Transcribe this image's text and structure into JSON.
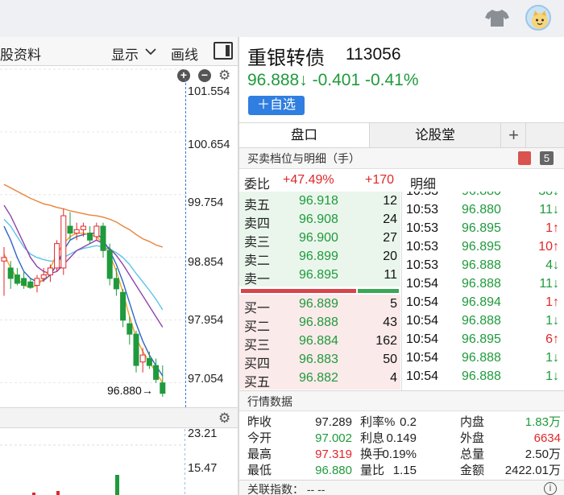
{
  "colors": {
    "up": "#e0262a",
    "down": "#1f9a3c",
    "accent": "#2f7ee0"
  },
  "topbar": {
    "icons": [
      "tshirt-icon",
      "avatar"
    ]
  },
  "left_toolbar": {
    "tab_partial": "股资料",
    "display": "显示",
    "display_icon": "chevron-down-icon",
    "draw": "画线",
    "layout_icon": "panel-toggle-icon"
  },
  "chart": {
    "price_labels": [
      "101.554",
      "100.654",
      "99.754",
      "98.854",
      "97.954",
      "97.054"
    ],
    "last_price": "96.880→",
    "sub_labels": [
      "23.21",
      "15.47"
    ],
    "zoom_icons": [
      "zoom-in-icon",
      "zoom-out-icon",
      "gear-icon"
    ]
  },
  "chart_data": {
    "type": "candlestick",
    "ylim": [
      96.7,
      101.6
    ],
    "candles": [
      {
        "o": 98.8,
        "h": 99.0,
        "l": 98.3,
        "c": 98.85
      },
      {
        "o": 98.7,
        "h": 98.8,
        "l": 98.4,
        "c": 98.55
      },
      {
        "o": 98.6,
        "h": 98.7,
        "l": 98.45,
        "c": 98.48
      },
      {
        "o": 98.55,
        "h": 98.65,
        "l": 98.4,
        "c": 98.45
      },
      {
        "o": 98.5,
        "h": 98.55,
        "l": 98.4,
        "c": 98.42
      },
      {
        "o": 98.45,
        "h": 98.6,
        "l": 98.35,
        "c": 98.55
      },
      {
        "o": 98.55,
        "h": 98.7,
        "l": 98.5,
        "c": 98.6
      },
      {
        "o": 98.6,
        "h": 98.75,
        "l": 98.5,
        "c": 98.7
      },
      {
        "o": 98.7,
        "h": 99.1,
        "l": 98.65,
        "c": 99.05
      },
      {
        "o": 98.7,
        "h": 99.55,
        "l": 98.6,
        "c": 99.45
      },
      {
        "o": 99.3,
        "h": 99.5,
        "l": 99.1,
        "c": 99.2
      },
      {
        "o": 99.2,
        "h": 99.35,
        "l": 99.1,
        "c": 99.25
      },
      {
        "o": 99.25,
        "h": 99.35,
        "l": 99.15,
        "c": 99.3
      },
      {
        "o": 99.2,
        "h": 99.3,
        "l": 99.05,
        "c": 99.1
      },
      {
        "o": 99.15,
        "h": 99.35,
        "l": 99.1,
        "c": 99.3
      },
      {
        "o": 99.3,
        "h": 99.35,
        "l": 98.85,
        "c": 98.95
      },
      {
        "o": 98.95,
        "h": 99.05,
        "l": 98.45,
        "c": 98.55
      },
      {
        "o": 98.55,
        "h": 98.7,
        "l": 98.3,
        "c": 98.4
      },
      {
        "o": 98.35,
        "h": 98.4,
        "l": 97.85,
        "c": 97.95
      },
      {
        "o": 97.9,
        "h": 98.0,
        "l": 97.6,
        "c": 97.75
      },
      {
        "o": 97.75,
        "h": 97.8,
        "l": 97.2,
        "c": 97.3
      },
      {
        "o": 97.35,
        "h": 97.55,
        "l": 97.2,
        "c": 97.45
      },
      {
        "o": 97.4,
        "h": 97.5,
        "l": 97.25,
        "c": 97.3
      },
      {
        "o": 97.3,
        "h": 97.4,
        "l": 97.05,
        "c": 97.1
      },
      {
        "o": 97.05,
        "h": 97.3,
        "l": 96.85,
        "c": 96.9
      }
    ],
    "ma": [
      {
        "color": "#e9833a",
        "values": [
          99.9,
          99.85,
          99.8,
          99.75,
          99.7,
          99.66,
          99.62,
          99.6,
          99.57,
          99.55,
          99.52,
          99.5,
          99.48,
          99.46,
          99.45,
          99.43,
          99.4,
          99.36,
          99.3,
          99.25,
          99.18,
          99.12,
          99.08,
          99.03,
          99.0
        ]
      },
      {
        "color": "#5bc4e6",
        "values": [
          99.4,
          99.3,
          99.15,
          99.0,
          98.9,
          98.85,
          98.82,
          98.8,
          98.8,
          98.85,
          98.9,
          98.95,
          98.98,
          99.0,
          99.02,
          99.0,
          98.97,
          98.92,
          98.85,
          98.75,
          98.62,
          98.5,
          98.38,
          98.25,
          98.1
        ]
      },
      {
        "color": "#8e44ad",
        "values": [
          99.6,
          99.45,
          99.25,
          99.05,
          98.85,
          98.72,
          98.65,
          98.62,
          98.65,
          98.75,
          98.85,
          98.95,
          99.0,
          99.05,
          99.1,
          99.05,
          98.98,
          98.88,
          98.75,
          98.6,
          98.45,
          98.3,
          98.15,
          98.0,
          97.85
        ]
      },
      {
        "color": "#2f66c8",
        "values": [
          99.3,
          99.1,
          98.85,
          98.65,
          98.55,
          98.5,
          98.52,
          98.6,
          98.75,
          98.95,
          99.1,
          99.15,
          99.18,
          99.2,
          99.2,
          99.1,
          98.95,
          98.75,
          98.5,
          98.2,
          97.9,
          97.65,
          97.45,
          97.3,
          97.15
        ]
      },
      {
        "color": "#f2a024",
        "values": [
          98.9,
          98.7,
          98.55,
          98.45,
          98.42,
          98.45,
          98.55,
          98.7,
          98.9,
          99.05,
          99.15,
          99.2,
          99.2,
          99.18,
          99.15,
          99.05,
          98.9,
          98.65,
          98.35,
          98.0,
          97.7,
          97.5,
          97.35,
          97.2,
          97.05
        ]
      }
    ]
  },
  "stock": {
    "name": "重银转债",
    "code": "113056",
    "price": "96.888↓",
    "change": "-0.401",
    "pct": "-0.41%",
    "add_button": "＋自选"
  },
  "tabs": [
    "盘口",
    "论股堂",
    "+"
  ],
  "order_section": {
    "title": "买卖档位与明细（手）",
    "badge": "5",
    "ratio_label": "委比",
    "ratio_value": "+47.49%",
    "ratio_diff": "+170",
    "detail_label": "明细"
  },
  "asks": [
    {
      "label": "卖五",
      "price": "96.918",
      "vol": "12"
    },
    {
      "label": "卖四",
      "price": "96.908",
      "vol": "24"
    },
    {
      "label": "卖三",
      "price": "96.900",
      "vol": "27"
    },
    {
      "label": "卖二",
      "price": "96.899",
      "vol": "20"
    },
    {
      "label": "卖一",
      "price": "96.895",
      "vol": "11"
    }
  ],
  "bids": [
    {
      "label": "买一",
      "price": "96.889",
      "vol": "5"
    },
    {
      "label": "买二",
      "price": "96.888",
      "vol": "43"
    },
    {
      "label": "买三",
      "price": "96.884",
      "vol": "162"
    },
    {
      "label": "买四",
      "price": "96.883",
      "vol": "50"
    },
    {
      "label": "买五",
      "price": "96.882",
      "vol": "4"
    }
  ],
  "ratio_bar": {
    "bid_fraction": 0.74
  },
  "trades": [
    {
      "time": "10:53",
      "price": "96.880",
      "vol": "38↓",
      "dir": "down"
    },
    {
      "time": "10:53",
      "price": "96.880",
      "vol": "11↓",
      "dir": "down"
    },
    {
      "time": "10:53",
      "price": "96.895",
      "vol": "1↑",
      "dir": "up"
    },
    {
      "time": "10:53",
      "price": "96.895",
      "vol": "10↑",
      "dir": "up"
    },
    {
      "time": "10:53",
      "price": "96.888",
      "vol": "4↓",
      "dir": "down"
    },
    {
      "time": "10:54",
      "price": "96.888",
      "vol": "11↓",
      "dir": "down"
    },
    {
      "time": "10:54",
      "price": "96.894",
      "vol": "1↑",
      "dir": "up"
    },
    {
      "time": "10:54",
      "price": "96.888",
      "vol": "1↓",
      "dir": "down"
    },
    {
      "time": "10:54",
      "price": "96.895",
      "vol": "6↑",
      "dir": "up"
    },
    {
      "time": "10:54",
      "price": "96.888",
      "vol": "1↓",
      "dir": "down"
    },
    {
      "time": "10:54",
      "price": "96.888",
      "vol": "1↓",
      "dir": "down"
    }
  ],
  "market_section": {
    "title": "行情数据"
  },
  "market": [
    [
      {
        "k": "昨收",
        "v": "97.289",
        "c": ""
      },
      {
        "k": "利率%",
        "v": "0.2",
        "c": ""
      },
      {
        "k": "内盘",
        "v": "1.83万",
        "c": "green"
      }
    ],
    [
      {
        "k": "今开",
        "v": "97.002",
        "c": "green"
      },
      {
        "k": "利息",
        "v": "0.149",
        "c": ""
      },
      {
        "k": "外盘",
        "v": "6634",
        "c": "red"
      }
    ],
    [
      {
        "k": "最高",
        "v": "97.319",
        "c": "red"
      },
      {
        "k": "换手",
        "v": "0.19%",
        "c": ""
      },
      {
        "k": "总量",
        "v": "2.50万",
        "c": ""
      }
    ],
    [
      {
        "k": "最低",
        "v": "96.880",
        "c": "green"
      },
      {
        "k": "量比",
        "v": "1.15",
        "c": ""
      },
      {
        "k": "金额",
        "v": "2422.01万",
        "c": ""
      }
    ]
  ],
  "related": {
    "label": "关联指数：",
    "value": "-- --"
  }
}
